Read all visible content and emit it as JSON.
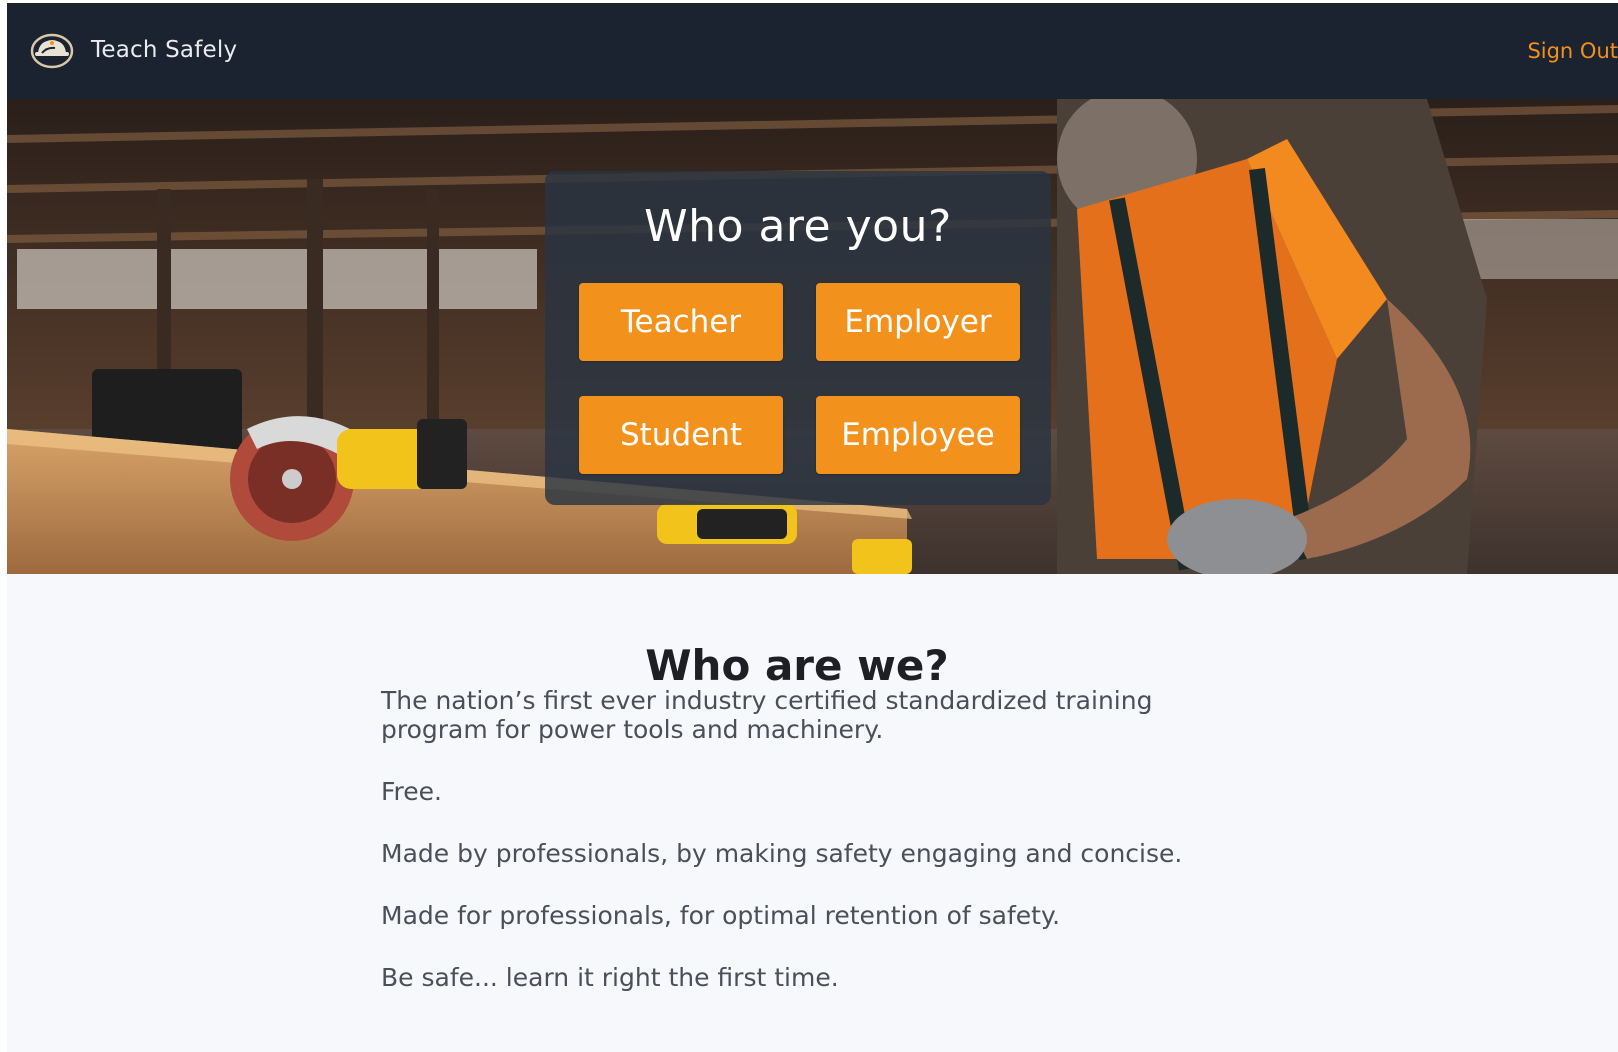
{
  "header": {
    "brand_name": "Teach Safely",
    "sign_out_label": "Sign Out",
    "logo_icon": "hard-hat-logo-icon",
    "background_color": "#1b2230",
    "accent_color": "#f2911c"
  },
  "hero": {
    "image_description_icon": "construction-worker-workshop-photo",
    "prompt_title": "Who are you?",
    "roles": [
      {
        "label": "Teacher"
      },
      {
        "label": "Employer"
      },
      {
        "label": "Student"
      },
      {
        "label": "Employee"
      }
    ],
    "button_color": "#f2911c"
  },
  "about": {
    "title": "Who are we?",
    "paragraphs": [
      "The nation’s first ever industry certified standardized training program for power tools and machinery.",
      "Free.",
      "Made by professionals, by making safety engaging and concise.",
      "Made for professionals, for optimal retention of safety.",
      "Be safe... learn it right the first time."
    ]
  }
}
